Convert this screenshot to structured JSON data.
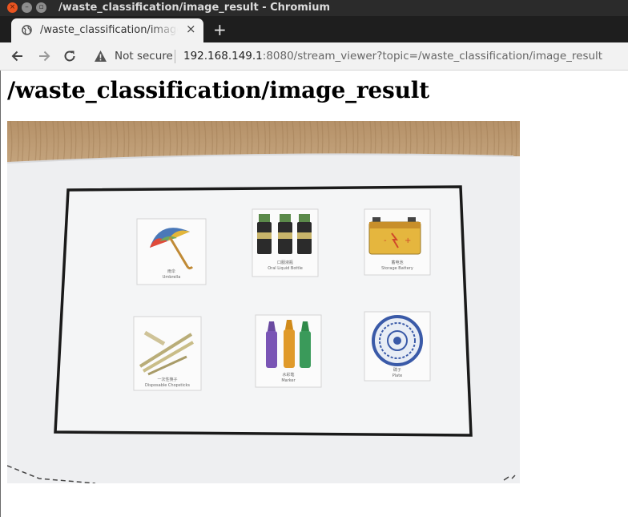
{
  "window": {
    "title": "/waste_classification/image_result - Chromium"
  },
  "tab": {
    "title": "/waste_classification/image_result",
    "close_glyph": "×",
    "new_tab_glyph": "+"
  },
  "toolbar": {
    "security_label": "Not secure",
    "url_host": "192.168.149.1",
    "url_rest": ":8080/stream_viewer?topic=/waste_classification/image_result"
  },
  "page": {
    "heading": "/waste_classification/image_result"
  },
  "stream": {
    "cards": [
      {
        "item": "umbrella",
        "cn": "雨伞",
        "en": "Umbrella"
      },
      {
        "item": "oral-liquid-bottle",
        "cn": "口服液瓶",
        "en": "Oral Liquid Bottle"
      },
      {
        "item": "storage-battery",
        "cn": "蓄电池",
        "en": "Storage Battery"
      },
      {
        "item": "disposable-chopsticks",
        "cn": "一次性筷子",
        "en": "Disposable Chopsticks"
      },
      {
        "item": "marker",
        "cn": "水彩笔",
        "en": "Marker"
      },
      {
        "item": "plate",
        "cn": "碟子",
        "en": "Plate"
      }
    ]
  },
  "colors": {
    "titlebar": "#2b2b2b",
    "close_button": "#e95420",
    "toolbar": "#f2f2f2"
  }
}
